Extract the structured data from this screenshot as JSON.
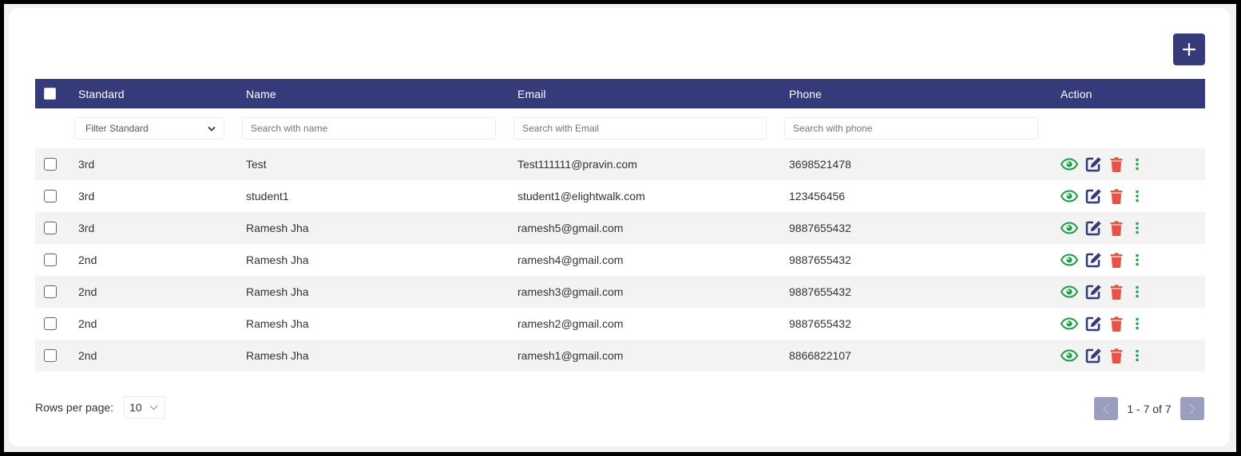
{
  "toolbar": {
    "add_icon": "plus-icon",
    "add_color": "#343a7a"
  },
  "table": {
    "header_color": "#343a7a",
    "columns": {
      "standard": "Standard",
      "name": "Name",
      "email": "Email",
      "phone": "Phone",
      "action": "Action"
    },
    "filters": {
      "standard": "Filter Standard",
      "name_placeholder": "Search with name",
      "email_placeholder": "Search with Email",
      "phone_placeholder": "Search with phone"
    },
    "rows": [
      {
        "standard": "3rd",
        "name": "Test",
        "email": "Test111111@pravin.com",
        "phone": "3698521478"
      },
      {
        "standard": "3rd",
        "name": "student1",
        "email": "student1@elightwalk.com",
        "phone": "123456456"
      },
      {
        "standard": "3rd",
        "name": "Ramesh Jha",
        "email": "ramesh5@gmail.com",
        "phone": "9887655432"
      },
      {
        "standard": "2nd",
        "name": "Ramesh Jha",
        "email": "ramesh4@gmail.com",
        "phone": "9887655432"
      },
      {
        "standard": "2nd",
        "name": "Ramesh Jha",
        "email": "ramesh3@gmail.com",
        "phone": "9887655432"
      },
      {
        "standard": "2nd",
        "name": "Ramesh Jha",
        "email": "ramesh2@gmail.com",
        "phone": "9887655432"
      },
      {
        "standard": "2nd",
        "name": "Ramesh Jha",
        "email": "ramesh1@gmail.com",
        "phone": "8866822107"
      }
    ],
    "action_icons": {
      "view": {
        "icon": "eye-icon",
        "color": "#1e9e4a"
      },
      "edit": {
        "icon": "edit-icon",
        "color": "#343a7a"
      },
      "delete": {
        "icon": "trash-icon",
        "color": "#e5534b"
      },
      "more": {
        "icon": "more-vertical-icon",
        "color": "#1e9e4a"
      }
    }
  },
  "pagination": {
    "rows_per_page_label": "Rows per page:",
    "rows_per_page_value": "10",
    "range_text": "1 - 7 of 7"
  }
}
